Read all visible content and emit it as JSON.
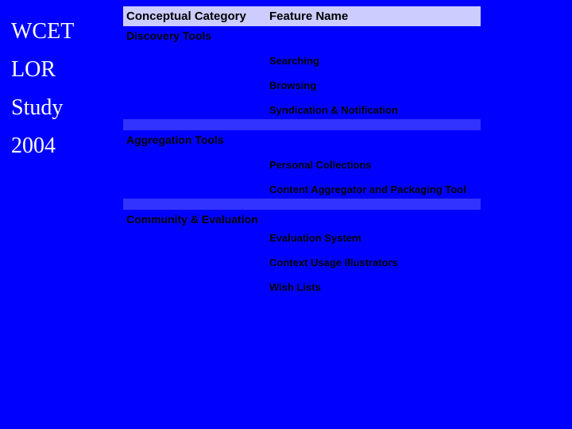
{
  "sidebar": {
    "line1": "WCET",
    "line2": "LOR",
    "line3": "Study",
    "line4": "2004"
  },
  "headers": {
    "category": "Conceptual Category",
    "feature": "Feature Name"
  },
  "sections": [
    {
      "category": "Discovery Tools",
      "features": [
        "Searching",
        "Browsing",
        "Syndication & Notification"
      ]
    },
    {
      "category": "Aggregation Tools",
      "features": [
        "Personal Collections",
        "Content Aggregator and Packaging Tool"
      ]
    },
    {
      "category": "Community & Evaluation",
      "features": [
        "Evaluation System",
        "Context Usage Illustrators",
        "Wish Lists"
      ]
    }
  ]
}
